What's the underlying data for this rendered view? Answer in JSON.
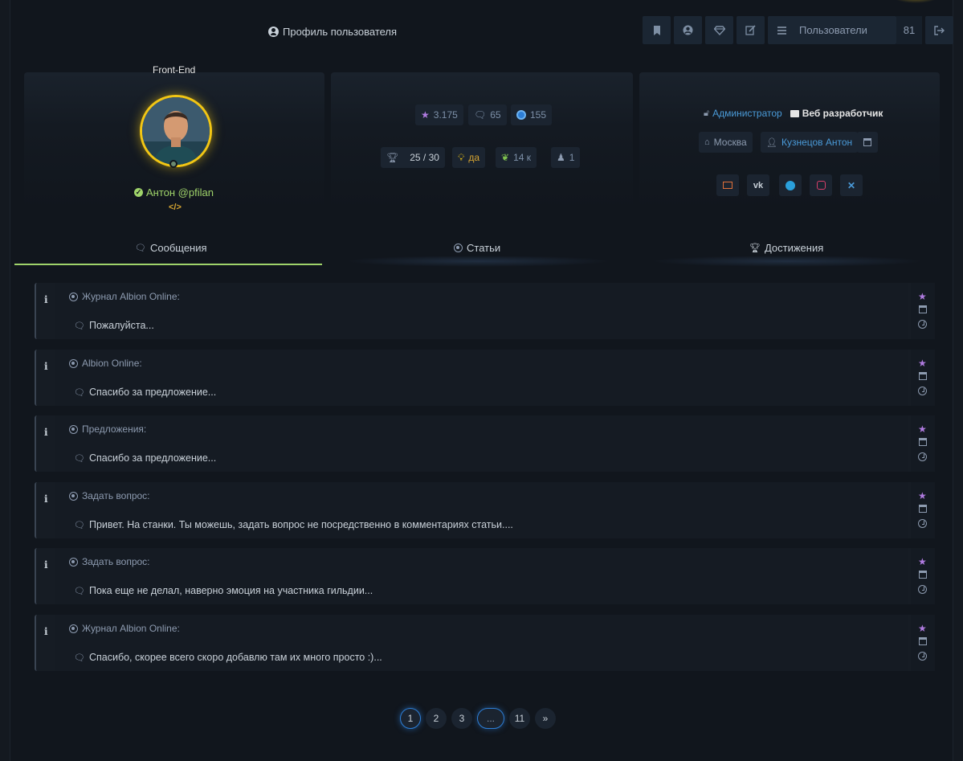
{
  "header": {
    "title": "Профиль пользователя",
    "users_label": "Пользователи",
    "users_count": "81"
  },
  "profile": {
    "role_tag": "Front-End",
    "name": "Антон @pfilan",
    "code_symbol": "</>"
  },
  "stats": {
    "rating": "3.175",
    "comments": "65",
    "posts": "155",
    "trophies": "25 / 30",
    "idea": "да",
    "leaf": "14 к",
    "rank": "1"
  },
  "info": {
    "role": "Администратор",
    "job": "Веб разработчик",
    "city": "Москва",
    "full_name": "Кузнецов Антон"
  },
  "tabs": [
    {
      "label": "Сообщения"
    },
    {
      "label": "Статьи"
    },
    {
      "label": "Достижения"
    }
  ],
  "messages": [
    {
      "topic": "Журнал Albion Online:",
      "text": "Пожалуйста..."
    },
    {
      "topic": "Albion Online:",
      "text": "Спасибо за предложение..."
    },
    {
      "topic": "Предложения:",
      "text": "Спасибо за предложение..."
    },
    {
      "topic": "Задать вопрос:",
      "text": "Привет. На станки. Ты можешь, задать вопрос не посредственно в комментариях статьи...."
    },
    {
      "topic": "Задать вопрос:",
      "text": "Пока еще не делал, наверно эмоция на участника гильдии..."
    },
    {
      "topic": "Журнал Albion Online:",
      "text": "Спасибо, скорее всего скоро добавлю там их много просто :)..."
    }
  ],
  "pagination": [
    "1",
    "2",
    "3",
    "...",
    "11",
    "»"
  ],
  "colors": {
    "accent_green": "#9fd36a",
    "avatar_ring": "#f2c614",
    "link_blue": "#4a9ad8",
    "star_purple": "#b07be0"
  }
}
